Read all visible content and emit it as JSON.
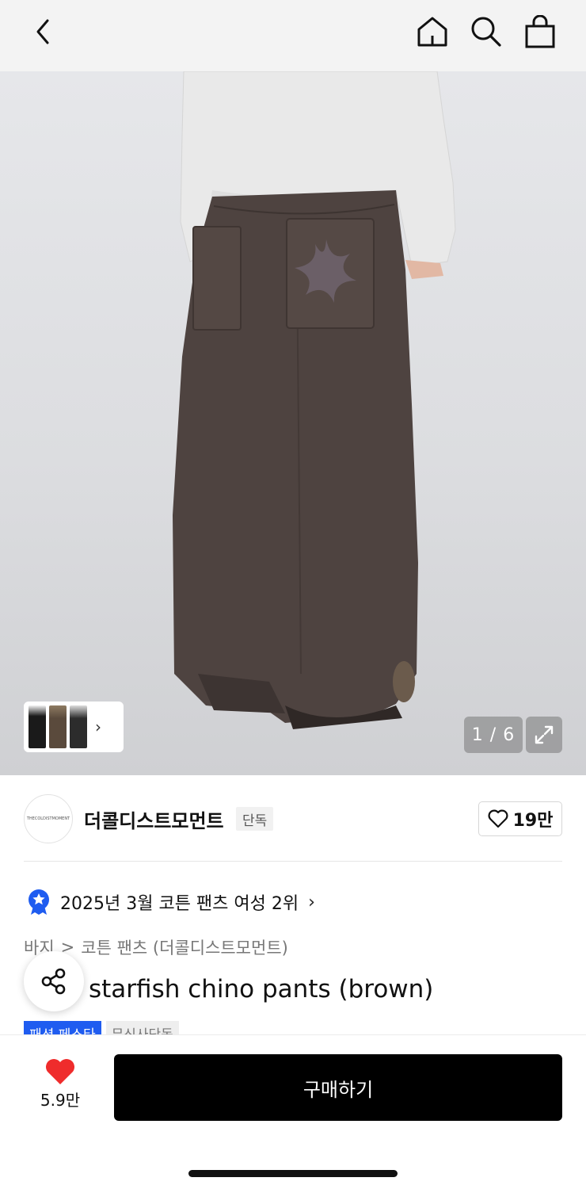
{
  "header": {
    "back_icon": "chevron-left-icon",
    "home_icon": "home-icon",
    "search_icon": "search-icon",
    "cart_icon": "shopping-bag-icon"
  },
  "gallery": {
    "counter": "1 / 6",
    "current": 1,
    "total": 6
  },
  "brand": {
    "logo_text": "THECOLDISTMOMENT",
    "name": "더콜디스트모먼트",
    "exclusive_badge": "단독",
    "likes": "19만"
  },
  "ranking": {
    "text": "2025년 3월 코튼 팬츠 여성 2위"
  },
  "breadcrumb": {
    "level1": "바지",
    "separator": ">",
    "level2": "코튼 팬츠 (더콜디스트모먼트)"
  },
  "product": {
    "title": "starfish chino pants (brown)"
  },
  "tags": [
    "패션 페스타",
    "무신사단독"
  ],
  "bottom": {
    "wish_count": "5.9만",
    "buy_label": "구매하기"
  },
  "colors": {
    "accent_blue": "#1f5cf0",
    "heart_red": "#ef2c2c",
    "pants_brown": "#4e4340"
  }
}
